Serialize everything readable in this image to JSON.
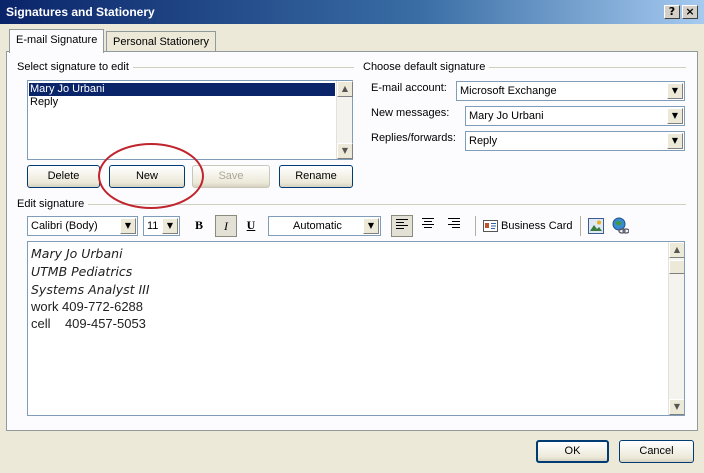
{
  "window": {
    "title": "Signatures and Stationery",
    "help_glyph": "?",
    "close_glyph": "×"
  },
  "tabs": [
    {
      "label": "E-mail Signature",
      "active": true
    },
    {
      "label": "Personal Stationery",
      "active": false
    }
  ],
  "select_signature": {
    "group_label": "Select signature to edit",
    "items": [
      {
        "label": "Mary Jo Urbani",
        "selected": true
      },
      {
        "label": "Reply",
        "selected": false
      }
    ],
    "buttons": {
      "delete": "Delete",
      "new": "New",
      "save": "Save",
      "rename": "Rename"
    }
  },
  "default_signature": {
    "group_label": "Choose default signature",
    "email_account_label": "E-mail account:",
    "email_account_value": "Microsoft Exchange",
    "new_messages_label": "New messages:",
    "new_messages_value": "Mary Jo Urbani",
    "replies_label": "Replies/forwards:",
    "replies_value": "Reply"
  },
  "edit_signature": {
    "group_label": "Edit signature",
    "font_name": "Calibri (Body)",
    "font_size": "11",
    "bold_label": "B",
    "italic_label": "I",
    "underline_label": "U",
    "color_value": "Automatic",
    "business_card_label": "Business Card",
    "lines": [
      "Mary Jo Urbani",
      "UTMB Pediatrics",
      "Systems Analyst III",
      "work 409-772-6288",
      "cell    409-457-5053"
    ]
  },
  "footer": {
    "ok": "OK",
    "cancel": "Cancel"
  },
  "colors": {
    "titlebar_start": "#0a246a",
    "selection": "#0a246a",
    "annotation_circle": "#c0252d",
    "dialog_bg": "#ece9d8"
  }
}
